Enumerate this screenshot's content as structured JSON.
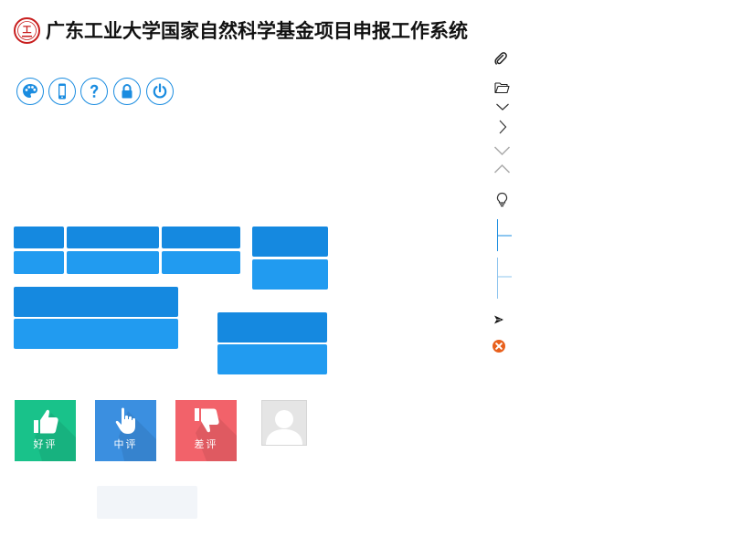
{
  "header": {
    "title": "广东工业大学国家自然科学基金项目申报工作系统",
    "logo_icon": "university-seal-icon"
  },
  "toolbar": {
    "buttons": [
      {
        "icon": "palette-icon"
      },
      {
        "icon": "mobile-phone-icon"
      },
      {
        "icon": "help-icon"
      },
      {
        "icon": "lock-icon"
      },
      {
        "icon": "power-icon"
      }
    ]
  },
  "ratings": {
    "good": {
      "label": "好评",
      "color": "#19c28a"
    },
    "neutral": {
      "label": "中评",
      "color": "#3b8fe0"
    },
    "bad": {
      "label": "差评",
      "color": "#f2626a"
    }
  },
  "right_icons": [
    "paperclip-icon",
    "folder-open-icon",
    "chevron-down-icon",
    "chevron-right-icon",
    "chevron-down-icon",
    "chevron-up-icon",
    "lightbulb-icon",
    "tree-branch-icon",
    "send-icon",
    "close-circle-icon"
  ],
  "colors": {
    "accent": "#1589e0",
    "accent_light": "#219bf0",
    "close_icon": "#e8601c"
  }
}
